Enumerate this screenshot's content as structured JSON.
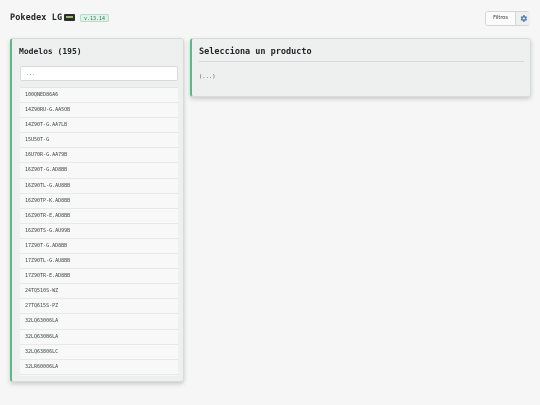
{
  "header": {
    "title": "Pokedex LG",
    "version": "v.13.14",
    "filters_label": "Filtros"
  },
  "models": {
    "title": "Modelos (195)",
    "search_placeholder": "...",
    "items": [
      "100QNED86A6",
      "14Z90RU-G.AA5OB",
      "14Z90T-G.AA7LB",
      "15U50T-G",
      "16U70R-G.AA79B",
      "16Z90T-G.AD8BB",
      "16Z90TL-G.AU8BB",
      "16Z90TP-K.AD8BB",
      "16Z90TR-E.AD8BB",
      "16Z90TS-G.AU99B",
      "17Z90T-G.AD8BB",
      "17Z90TL-G.AU8BB",
      "17Z90TR-E.AD8BB",
      "24TQ510S-WZ",
      "27TQ615S-PZ",
      "32LQ63006LA",
      "32LQ630B6LA",
      "32LQ63806LC",
      "32LR60006LA"
    ]
  },
  "detail": {
    "title": "Selecciona un producto",
    "body": "(...)"
  },
  "colors": {
    "accent": "#5bb887",
    "background": "#f5f6f5",
    "panel": "#eef0ef"
  }
}
